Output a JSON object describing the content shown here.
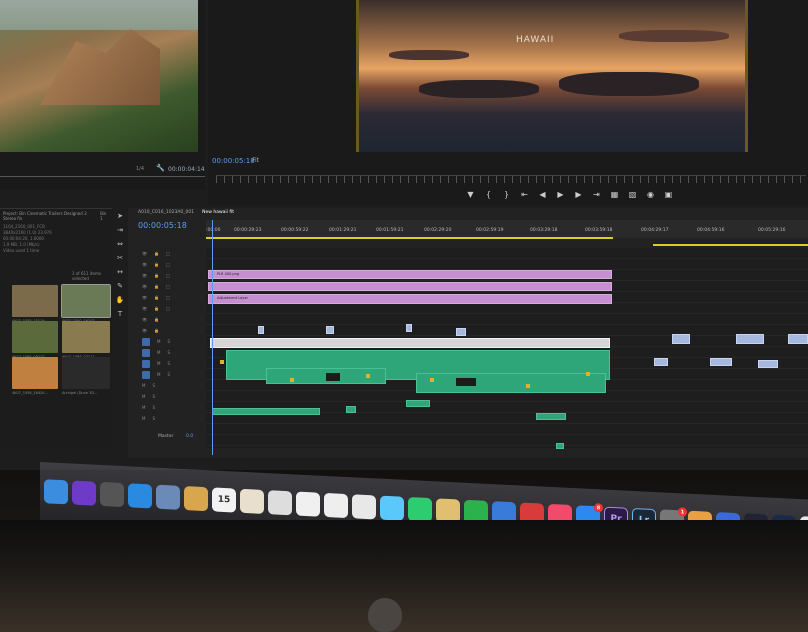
{
  "source_monitor": {
    "timecode": "00:00:04:14",
    "ratio": "1/4"
  },
  "program_monitor": {
    "title_overlay": "HAWAII",
    "timecode": "00:00:05:18",
    "zoom": "Fit",
    "transport_icons": [
      "marker-icon",
      "in-point-icon",
      "out-point-icon",
      "go-to-in-icon",
      "step-back-icon",
      "play-icon",
      "step-forward-icon",
      "go-to-out-icon",
      "lift-icon",
      "extract-icon",
      "export-frame-icon",
      "compare-icon"
    ]
  },
  "project_panel": {
    "tabs": [
      "Project: Bin Cinematic Trailers Designed 3 Stereo fin",
      "Bin 1"
    ],
    "info_lines": [
      "1104_2160_001_FCB",
      "3840x2160 (1.0) 23.976",
      "00:00:04:20, 1.0000",
      "1.9 MB, 1.0 (Mb/s)",
      "Video used 1 time"
    ],
    "items_selected": "1 of 611 items selected",
    "thumbnails": [
      {
        "label": "4K07_1555_15119...",
        "color": "#7b6b4a"
      },
      {
        "label": "4K07_1550_16107...",
        "color": "#6a7a56"
      },
      {
        "label": "4K07_1565_09210...",
        "color": "#5a6a3a"
      },
      {
        "label": "4K07_1565_07211...",
        "color": "#8a7a50"
      },
      {
        "label": "4K07_1556_16420...",
        "color": "#c08040"
      },
      {
        "label": "Archipel (Dune 3D...",
        "color": "#4a3a2a"
      }
    ]
  },
  "timeline": {
    "tabs": [
      "A010_C016_1023A0_001",
      "New hawaii fit"
    ],
    "timecode": "00:00:05:18",
    "ruler_labels": [
      {
        "text": ":00:00",
        "pos": 0
      },
      {
        "text": "00:00:29:23",
        "pos": 28
      },
      {
        "text": "00:00:59:22",
        "pos": 75
      },
      {
        "text": "00:01:29:21",
        "pos": 123
      },
      {
        "text": "00:01:59:21",
        "pos": 170
      },
      {
        "text": "00:02:29:20",
        "pos": 218
      },
      {
        "text": "00:02:59:19",
        "pos": 270
      },
      {
        "text": "00:03:29:18",
        "pos": 324
      },
      {
        "text": "00:03:59:18",
        "pos": 379
      },
      {
        "text": "00:04:29:17",
        "pos": 435
      },
      {
        "text": "00:04:59:16",
        "pos": 491
      },
      {
        "text": "00:05:29:16",
        "pos": 552
      }
    ],
    "master_label": "Master",
    "master_value": "0.0",
    "clip_labels": {
      "v_top": "PLR 400.png",
      "v_adj": "Adjustment Layer"
    }
  },
  "dock": {
    "apps": [
      {
        "name": "finder-icon",
        "label": "",
        "color": "#3b8de0"
      },
      {
        "name": "siri-icon",
        "label": "",
        "color": "#6d3bc7"
      },
      {
        "name": "launchpad-icon",
        "label": "",
        "color": "#555"
      },
      {
        "name": "safari-icon",
        "label": "",
        "color": "#2a8ae0"
      },
      {
        "name": "preview-icon",
        "label": "",
        "color": "#6a8ab8"
      },
      {
        "name": "notes-icon",
        "label": "",
        "color": "#d8a64c"
      },
      {
        "name": "calendar-icon",
        "label": "15",
        "color": "#f2f2f2"
      },
      {
        "name": "textedit-icon",
        "label": "",
        "color": "#e8e0cc"
      },
      {
        "name": "script-icon",
        "label": "",
        "color": "#ddd"
      },
      {
        "name": "pages-icon",
        "label": "",
        "color": "#f0f0f0"
      },
      {
        "name": "reminders-icon",
        "label": "",
        "color": "#eee"
      },
      {
        "name": "photos-icon",
        "label": "",
        "color": "#e8e8e8"
      },
      {
        "name": "messages-icon",
        "label": "",
        "color": "#5ac8fa"
      },
      {
        "name": "facetime-icon",
        "label": "",
        "color": "#2ecc71"
      },
      {
        "name": "books-icon",
        "label": "",
        "color": "#e0c070"
      },
      {
        "name": "numbers-icon",
        "label": "",
        "color": "#2bb24c"
      },
      {
        "name": "keynote-icon",
        "label": "",
        "color": "#3a7ad8"
      },
      {
        "name": "no-entry-icon",
        "label": "",
        "color": "#d93a3a"
      },
      {
        "name": "music-icon",
        "label": "",
        "color": "#f24a6a"
      },
      {
        "name": "app-store-icon",
        "label": "",
        "color": "#2a8af0",
        "badge": "8"
      },
      {
        "name": "premiere-icon",
        "label": "Pr",
        "color": "#2a1a4a"
      },
      {
        "name": "lightroom-icon",
        "label": "Lr",
        "color": "#1c2838"
      },
      {
        "name": "system-preferences-icon",
        "label": "",
        "color": "#777",
        "badge": "1"
      },
      {
        "name": "folder-icon",
        "label": "",
        "color": "#e8a040"
      },
      {
        "name": "downloads-icon",
        "label": "",
        "color": "#3a6ad8"
      },
      {
        "name": "compressor-icon",
        "label": "",
        "color": "#223"
      },
      {
        "name": "media-encoder-icon",
        "label": "",
        "color": "#1a2a4a"
      },
      {
        "name": "document-icon",
        "label": "",
        "color": "#e8e8e8"
      },
      {
        "name": "trash-icon",
        "label": "",
        "color": "#aab"
      }
    ]
  }
}
